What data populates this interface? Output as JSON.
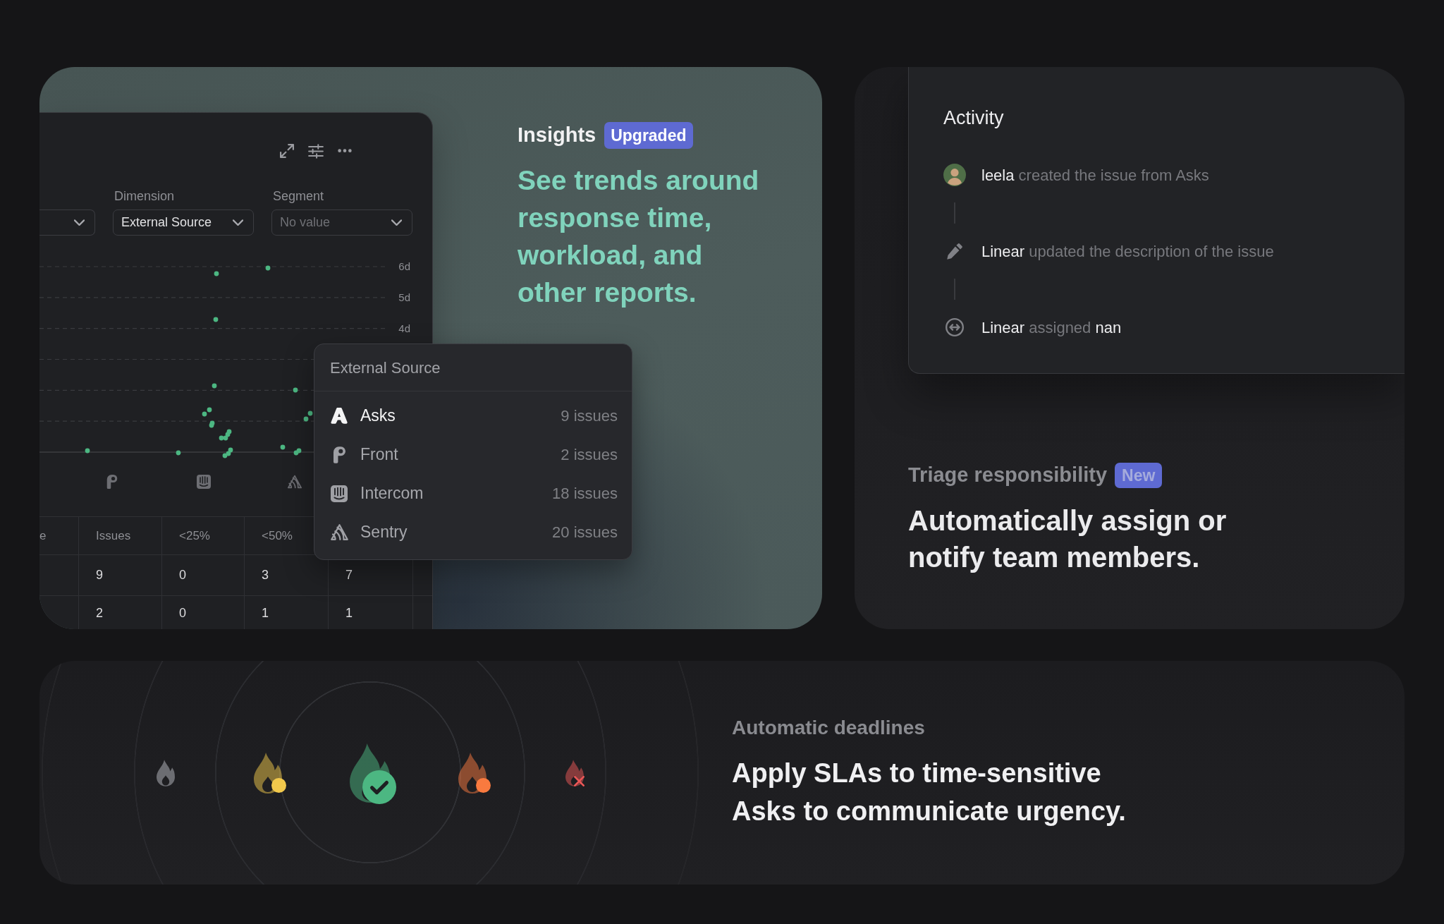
{
  "insights_card": {
    "report_panel": {
      "filters": [
        {
          "label": "Dimension",
          "value": "External Source"
        },
        {
          "label": "Segment",
          "placeholder": "No value"
        }
      ],
      "chart": {
        "y_ticks": [
          "6d",
          "5d",
          "4d"
        ]
      },
      "table": {
        "columns": [
          "e",
          "Issues",
          "<25%",
          "<50%",
          ""
        ],
        "rows": [
          {
            "cells": [
              "",
              "9",
              "0",
              "3",
              "7"
            ]
          },
          {
            "cells": [
              "",
              "2",
              "0",
              "1",
              "1"
            ]
          }
        ]
      }
    },
    "source_menu": {
      "title": "External Source",
      "items": [
        {
          "kind": "asks",
          "label": "Asks",
          "count": "9 issues",
          "selected": true
        },
        {
          "kind": "front",
          "label": "Front",
          "count": "2 issues",
          "selected": false
        },
        {
          "kind": "intercom",
          "label": "Intercom",
          "count": "18 issues",
          "selected": false
        },
        {
          "kind": "sentry",
          "label": "Sentry",
          "count": "20 issues",
          "selected": false
        }
      ]
    },
    "title": "Insights",
    "badge": "Upgraded",
    "headline": "See trends around response time, workload, and other reports."
  },
  "triage_card": {
    "activity": {
      "title": "Activity",
      "events": [
        {
          "kind": "avatar",
          "actor": "leela",
          "action": "created the issue from Asks"
        },
        {
          "kind": "edit",
          "actor": "Linear",
          "action": "updated the description of the issue"
        },
        {
          "kind": "assign",
          "actor": "Linear",
          "action": "assigned",
          "target": "nan"
        }
      ]
    },
    "title": "Triage responsibility",
    "badge": "New",
    "headline": "Automatically assign or notify team members."
  },
  "deadlines_card": {
    "stages": [
      {
        "kind": "plain"
      },
      {
        "kind": "dot",
        "color": "#f2c94c"
      },
      {
        "kind": "check",
        "color": "#4cb782"
      },
      {
        "kind": "dot",
        "color": "#f97a3f"
      },
      {
        "kind": "cross",
        "color": "#eb5757"
      }
    ],
    "title": "Automatic deadlines",
    "headline": "Apply SLAs to time-sensitive Asks to communicate urgency."
  }
}
